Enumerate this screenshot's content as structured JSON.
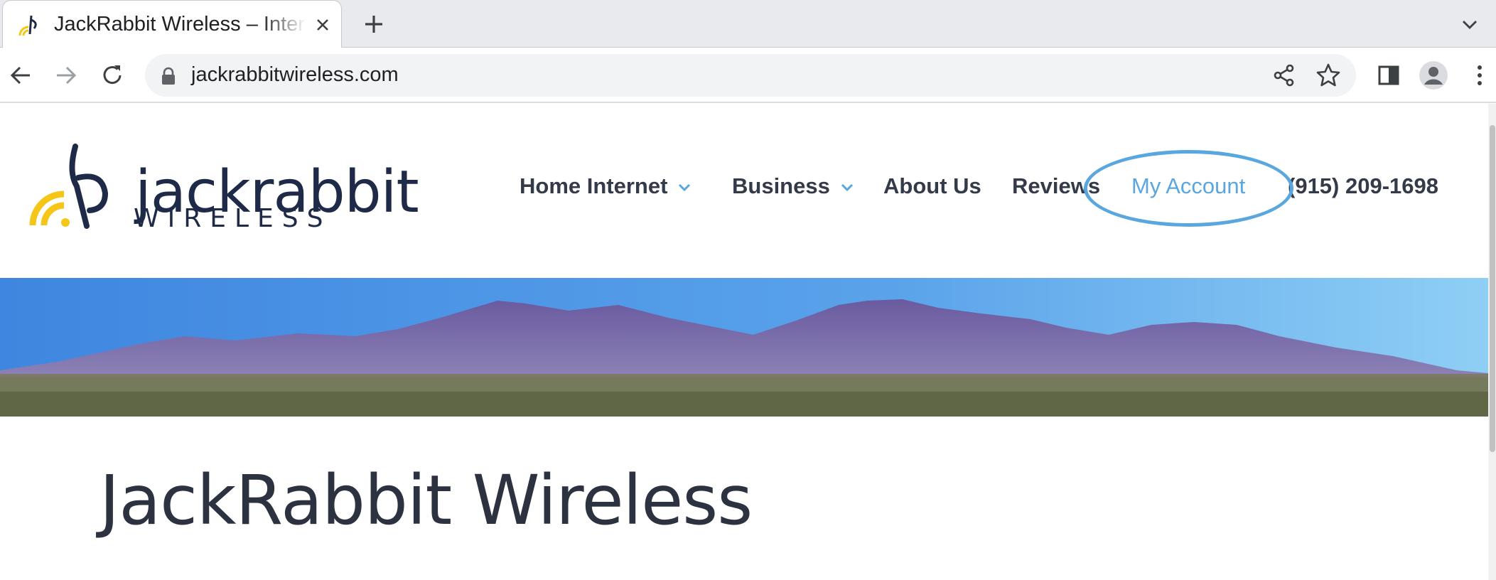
{
  "browser": {
    "tab_title": "JackRabbit Wireless – Internet Service",
    "url": "jackrabbitwireless.com"
  },
  "site": {
    "logo_word": "jackrabbit",
    "logo_sub": "WIRELESS",
    "nav": [
      {
        "label": "Home Internet",
        "has_dropdown": true
      },
      {
        "label": "Business",
        "has_dropdown": true
      },
      {
        "label": "About Us",
        "has_dropdown": false
      },
      {
        "label": "Reviews",
        "has_dropdown": false
      },
      {
        "label": "My Account",
        "has_dropdown": false,
        "highlighted": true
      },
      {
        "label": "(915) 209-1698",
        "has_dropdown": false
      }
    ],
    "heading": "JackRabbit Wireless"
  },
  "colors": {
    "accent": "#5aa7e0",
    "nav_text": "#333a48",
    "logo_navy": "#1e2a47",
    "logo_yellow": "#f5c518"
  }
}
